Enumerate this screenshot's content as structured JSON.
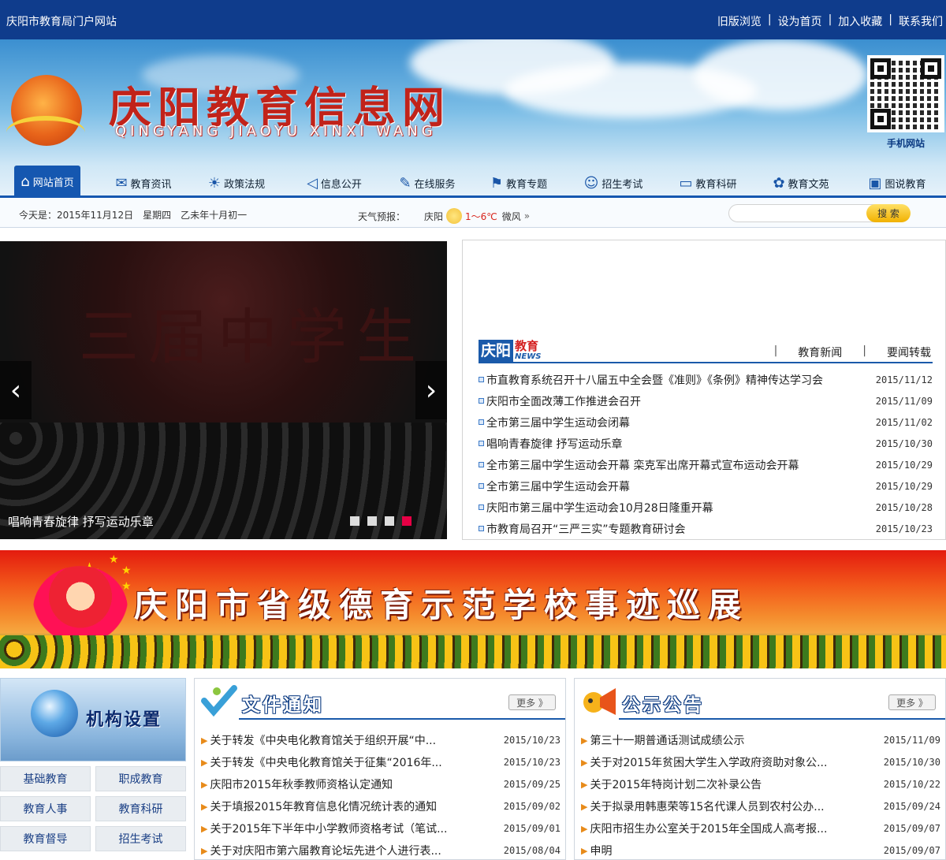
{
  "topbar": {
    "site_name": "庆阳市教育局门户网站",
    "links": [
      "旧版浏览",
      "设为首页",
      "加入收藏",
      "联系我们"
    ]
  },
  "header": {
    "logo_title": "庆阳教育信息网",
    "logo_subtitle": "QINGYANG JIAOYU XINXI WANG",
    "qr_label": "手机网站"
  },
  "nav": {
    "items": [
      {
        "label": "网站首页",
        "icon": "home-icon",
        "active": true
      },
      {
        "label": "教育资讯",
        "icon": "news-icon"
      },
      {
        "label": "政策法规",
        "icon": "bulb-icon"
      },
      {
        "label": "信息公开",
        "icon": "speaker-icon"
      },
      {
        "label": "在线服务",
        "icon": "wrench-icon"
      },
      {
        "label": "教育专题",
        "icon": "pin-icon"
      },
      {
        "label": "招生考试",
        "icon": "people-icon"
      },
      {
        "label": "教育科研",
        "icon": "folder-icon"
      },
      {
        "label": "教育文苑",
        "icon": "hat-icon"
      },
      {
        "label": "图说教育",
        "icon": "camera-icon"
      }
    ]
  },
  "infobar": {
    "date_text": "今天是：2015年11月12日　星期四　乙未年十月初一",
    "weather_label": "天气预报：",
    "city": "庆阳",
    "temp": "1～6℃",
    "wind": "微风",
    "search_button": "搜 索",
    "search_placeholder": ""
  },
  "slider": {
    "caption": "唱响青春旋律 抒写运动乐章",
    "stage_text": "三届中学生",
    "dots": 4,
    "active_dot": 3
  },
  "news": {
    "logo_main": "庆阳",
    "logo_edu": "教育",
    "logo_news": "NEWS",
    "tabs": [
      "教育新闻",
      "要闻转载"
    ],
    "items": [
      {
        "title": "市直教育系统召开十八届五中全会暨《准则》《条例》精神传达学习会",
        "date": "2015/11/12"
      },
      {
        "title": "庆阳市全面改薄工作推进会召开",
        "date": "2015/11/09"
      },
      {
        "title": "全市第三届中学生运动会闭幕",
        "date": "2015/11/02"
      },
      {
        "title": "唱响青春旋律 抒写运动乐章",
        "date": "2015/10/30"
      },
      {
        "title": "全市第三届中学生运动会开幕 栾克军出席开幕式宣布运动会开幕",
        "date": "2015/10/29"
      },
      {
        "title": "全市第三届中学生运动会开幕",
        "date": "2015/10/29"
      },
      {
        "title": "庆阳市第三届中学生运动会10月28日隆重开幕",
        "date": "2015/10/28"
      },
      {
        "title": "市教育局召开“三严三实”专题教育研讨会",
        "date": "2015/10/23"
      }
    ]
  },
  "promo": {
    "title": "庆阳市省级德育示范学校事迹巡展"
  },
  "sidebar": {
    "title": "机构设置",
    "buttons": [
      "基础教育",
      "职成教育",
      "教育人事",
      "教育科研",
      "教育督导",
      "招生考试"
    ]
  },
  "notices": {
    "title": "文件通知",
    "more": "更多 》",
    "items": [
      {
        "title": "关于转发《中央电化教育馆关于组织开展“中...",
        "date": "2015/10/23"
      },
      {
        "title": "关于转发《中央电化教育馆关于征集“2016年...",
        "date": "2015/10/23"
      },
      {
        "title": "庆阳市2015年秋季教师资格认定通知",
        "date": "2015/09/25"
      },
      {
        "title": "关于填报2015年教育信息化情况统计表的通知",
        "date": "2015/09/02"
      },
      {
        "title": "关于2015年下半年中小学教师资格考试（笔试...",
        "date": "2015/09/01"
      },
      {
        "title": "关于对庆阳市第六届教育论坛先进个人进行表...",
        "date": "2015/08/04"
      }
    ]
  },
  "announcements": {
    "title": "公示公告",
    "more": "更多 》",
    "items": [
      {
        "title": "第三十一期普通话测试成绩公示",
        "date": "2015/11/09"
      },
      {
        "title": "关于对2015年贫困大学生入学政府资助对象公...",
        "date": "2015/10/30"
      },
      {
        "title": "关于2015年特岗计划二次补录公告",
        "date": "2015/10/22"
      },
      {
        "title": "关于拟录用韩惠荣等15名代课人员到农村公办...",
        "date": "2015/09/24"
      },
      {
        "title": "庆阳市招生办公室关于2015年全国成人高考报...",
        "date": "2015/09/07"
      },
      {
        "title": "申明",
        "date": "2015/09/07"
      }
    ]
  }
}
